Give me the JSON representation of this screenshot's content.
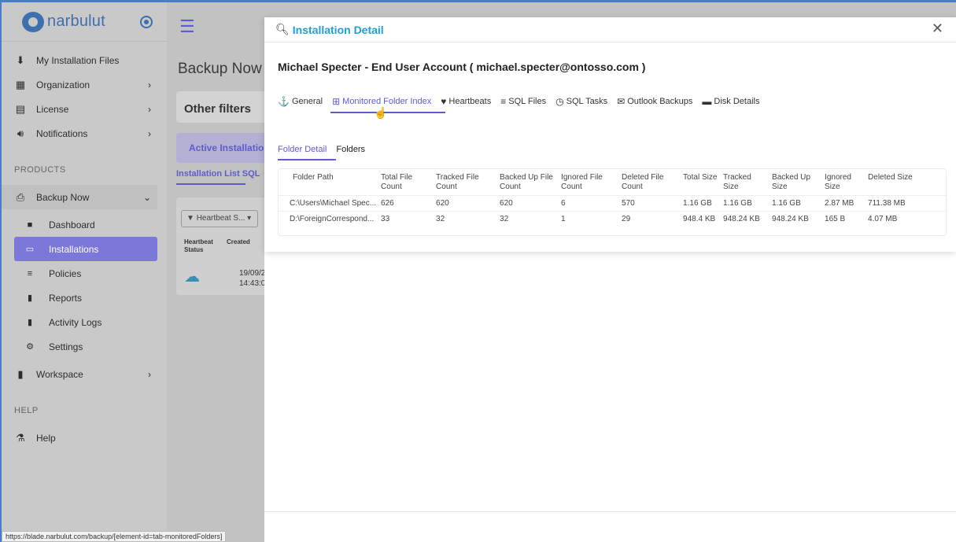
{
  "sidebar": {
    "logo_text": "narbulut",
    "items": [
      {
        "label": "My Installation Files",
        "icon": "download-icon"
      },
      {
        "label": "Organization",
        "icon": "grid-icon"
      },
      {
        "label": "License",
        "icon": "license-icon"
      },
      {
        "label": "Notifications",
        "icon": "speaker-icon"
      }
    ],
    "products_title": "PRODUCTS",
    "backup_now": "Backup Now",
    "subitems": [
      {
        "label": "Dashboard",
        "icon": "dashboard-icon"
      },
      {
        "label": "Installations",
        "icon": "monitor-icon"
      },
      {
        "label": "Policies",
        "icon": "list-icon"
      },
      {
        "label": "Reports",
        "icon": "report-icon"
      },
      {
        "label": "Activity Logs",
        "icon": "log-icon"
      },
      {
        "label": "Settings",
        "icon": "gears-icon"
      }
    ],
    "workspace": "Workspace",
    "help_title": "HELP",
    "help": "Help"
  },
  "status_url": "https://blade.narbulut.com/backup/[element-id=tab-monitoredFolders]",
  "main": {
    "title": "Backup Now -",
    "other_filters": "Other filters",
    "active_tab": "Active Installation",
    "installation_tabs": "Installation List   SQL",
    "heartbeat_filter": "Heartbeat S...",
    "col_heartbeat": "Heartbeat Status",
    "col_created": "Created",
    "row_date": "19/09/2",
    "row_time": "14:43:0"
  },
  "modal": {
    "title": "Installation Detail",
    "account": "Michael Specter - End User Account ( michael.specter@ontosso.com )",
    "tabs": [
      {
        "label": "General",
        "icon": "⚓"
      },
      {
        "label": "Monitored Folder Index",
        "icon": "⊞"
      },
      {
        "label": "Heartbeats",
        "icon": "♥"
      },
      {
        "label": "SQL Files",
        "icon": "≡"
      },
      {
        "label": "SQL Tasks",
        "icon": "◷"
      },
      {
        "label": "Outlook Backups",
        "icon": "✉"
      },
      {
        "label": "Disk Details",
        "icon": "▬"
      }
    ],
    "subtabs": [
      "Folder Detail",
      "Folders"
    ],
    "table": {
      "headers": [
        "Folder Path",
        "Total File Count",
        "Tracked File Count",
        "Backed Up File Count",
        "Ignored File Count",
        "Deleted File Count",
        "Total Size",
        "Tracked Size",
        "Backed Up Size",
        "Ignored Size",
        "Deleted Size"
      ],
      "rows": [
        [
          "C:\\Users\\Michael Spec...",
          "626",
          "620",
          "620",
          "6",
          "570",
          "1.16 GB",
          "1.16 GB",
          "1.16 GB",
          "2.87 MB",
          "711.38 MB"
        ],
        [
          "D:\\ForeignCorrespond...",
          "33",
          "32",
          "32",
          "1",
          "29",
          "948.4 KB",
          "948.24 KB",
          "948.24 KB",
          "165 B",
          "4.07 MB"
        ]
      ]
    }
  }
}
